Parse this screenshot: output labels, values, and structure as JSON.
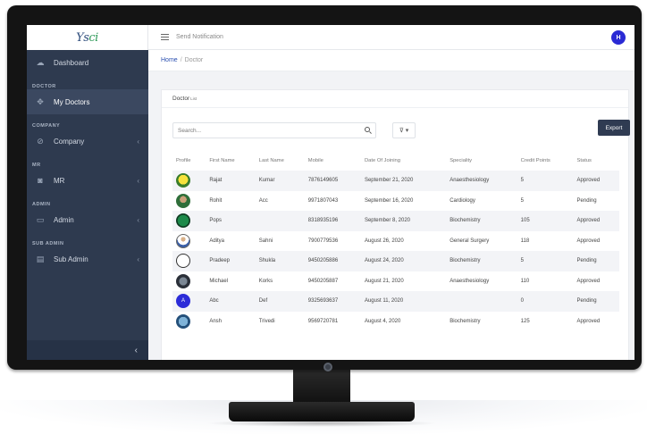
{
  "app": {
    "logo_main": "Ys",
    "logo_accent": "ci"
  },
  "sidebar": {
    "items": [
      {
        "type": "item",
        "label": "Dashboard",
        "icon": "cloud-icon",
        "chevron": false
      },
      {
        "type": "section",
        "label": "DOCTOR"
      },
      {
        "type": "item",
        "label": "My Doctors",
        "icon": "crosshair-icon",
        "chevron": false,
        "active": true
      },
      {
        "type": "section",
        "label": "COMPANY"
      },
      {
        "type": "item",
        "label": "Company",
        "icon": "tag-icon",
        "chevron": true
      },
      {
        "type": "section",
        "label": "MR"
      },
      {
        "type": "item",
        "label": "MR",
        "icon": "camera-icon",
        "chevron": true
      },
      {
        "type": "section",
        "label": "ADMIN"
      },
      {
        "type": "item",
        "label": "Admin",
        "icon": "card-icon",
        "chevron": true
      },
      {
        "type": "section",
        "label": "SUB ADMIN"
      },
      {
        "type": "item",
        "label": "Sub Admin",
        "icon": "doc-icon",
        "chevron": true
      }
    ],
    "collapse_glyph": "‹"
  },
  "topbar": {
    "title": "Send Notification",
    "avatar_letter": "H"
  },
  "breadcrumb": {
    "home": "Home",
    "separator": "/",
    "current": "Doctor"
  },
  "card": {
    "title": "Doctor",
    "title_suffix": "List"
  },
  "toolbar": {
    "search_placeholder": "Search...",
    "filter_glyph": "⊽ ▾",
    "export_label": "Export"
  },
  "table": {
    "headers": [
      "Profile",
      "First Name",
      "Last Name",
      "Mobile",
      "Date Of Joining",
      "Speciality",
      "Credit Points",
      "Status"
    ],
    "rows": [
      {
        "avatar": "yellow",
        "first": "Rajat",
        "last": "Kumar",
        "mobile": "7876149605",
        "date": "September 21, 2020",
        "speciality": "Anaesthesiology",
        "credit": "5",
        "status": "Approved"
      },
      {
        "avatar": "photo",
        "first": "Rohit",
        "last": "Acc",
        "mobile": "9971807043",
        "date": "September 16, 2020",
        "speciality": "Cardiology",
        "credit": "5",
        "status": "Pending"
      },
      {
        "avatar": "green",
        "first": "Pops",
        "last": "",
        "mobile": "8318935196",
        "date": "September 8, 2020",
        "speciality": "Biochemistry",
        "credit": "105",
        "status": "Approved"
      },
      {
        "avatar": "person",
        "first": "Aditya",
        "last": "Sahni",
        "mobile": "7900779536",
        "date": "August 26, 2020",
        "speciality": "General Surgery",
        "credit": "118",
        "status": "Approved"
      },
      {
        "avatar": "empty",
        "first": "Pradeep",
        "last": "Shukla",
        "mobile": "9450205886",
        "date": "August 24, 2020",
        "speciality": "Biochemistry",
        "credit": "5",
        "status": "Pending"
      },
      {
        "avatar": "dark",
        "first": "Michael",
        "last": "Korks",
        "mobile": "9450205887",
        "date": "August 21, 2020",
        "speciality": "Anaesthesiology",
        "credit": "110",
        "status": "Approved"
      },
      {
        "avatar": "letter",
        "letter": "A",
        "first": "Abc",
        "last": "Def",
        "mobile": "9325693637",
        "date": "August 11, 2020",
        "speciality": "",
        "credit": "0",
        "status": "Pending"
      },
      {
        "avatar": "blue",
        "first": "Ansh",
        "last": "Trivedi",
        "mobile": "9569720781",
        "date": "August 4, 2020",
        "speciality": "Biochemistry",
        "credit": "125",
        "status": "Approved"
      }
    ]
  },
  "colors": {
    "sidebar": "#2e3a4f",
    "accent": "#2a2ad4",
    "export_button": "#2f3b52"
  }
}
